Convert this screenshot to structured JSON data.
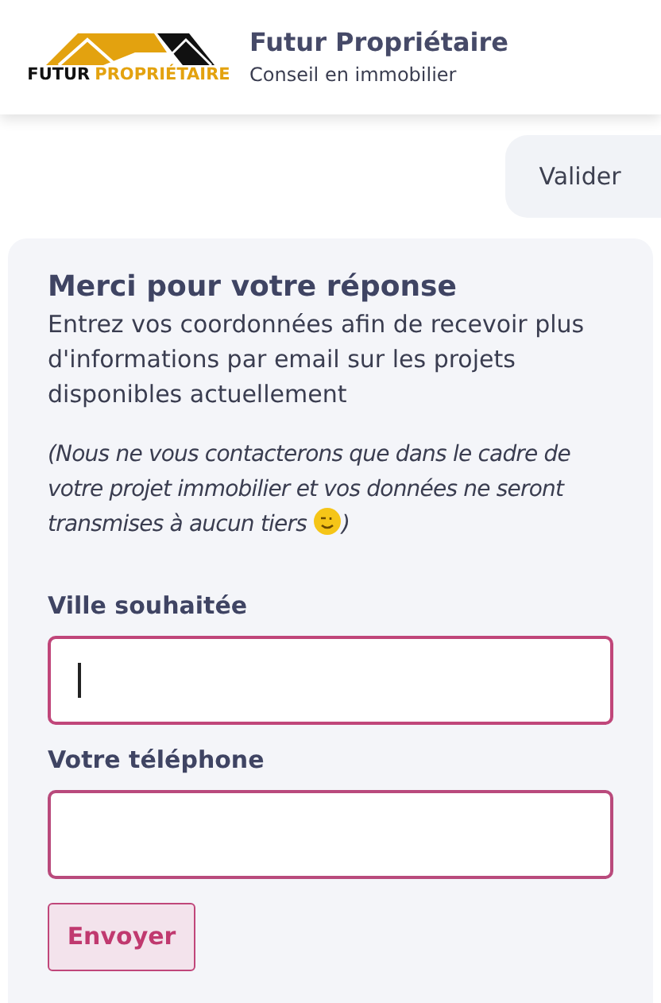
{
  "header": {
    "logo": {
      "word_1": "FUTUR",
      "word_2": "PROPRIÉTAIRE"
    },
    "title": "Futur Propriétaire",
    "subtitle": "Conseil en immobilier"
  },
  "chat": {
    "reply": "Valider"
  },
  "form": {
    "title": "Merci pour votre réponse",
    "intro": "Entrez vos coordonnées afin de recevoir plus d'informations par email sur les projets disponibles actuellement",
    "note": "(Nous ne vous contacterons que dans le cadre de votre projet immobilier et vos données ne seront transmises à aucun tiers",
    "note_end": ")",
    "fields": [
      {
        "label": "Ville souhaitée",
        "focused": true
      },
      {
        "label": "Votre téléphone",
        "focused": false
      }
    ],
    "submit": "Envoyer"
  }
}
